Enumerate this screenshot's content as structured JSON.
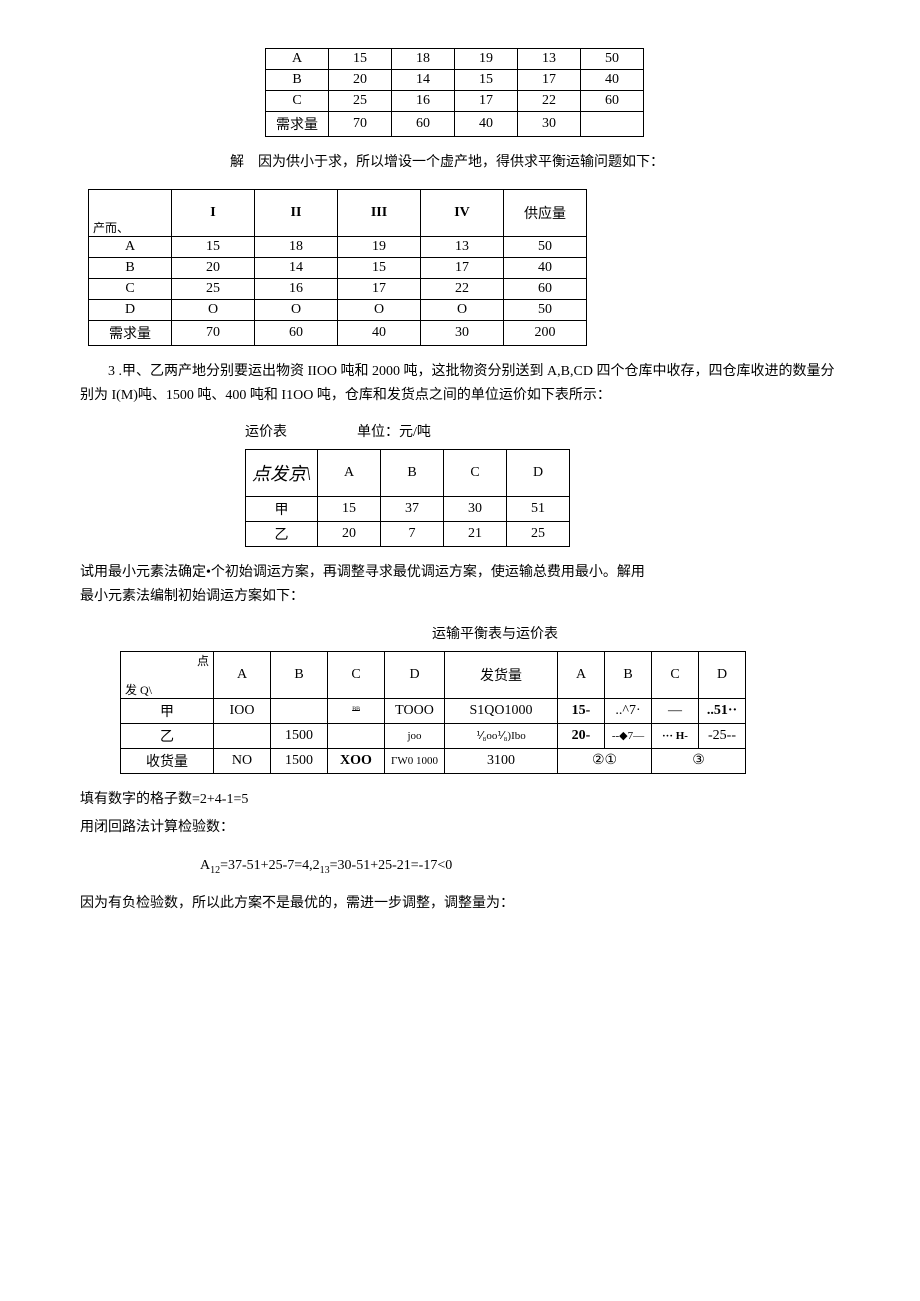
{
  "table1": {
    "rows": [
      [
        "A",
        "15",
        "18",
        "19",
        "13",
        "50"
      ],
      [
        "B",
        "20",
        "14",
        "15",
        "17",
        "40"
      ],
      [
        "C",
        "25",
        "16",
        "17",
        "22",
        "60"
      ],
      [
        "需求量",
        "70",
        "60",
        "40",
        "30",
        ""
      ]
    ]
  },
  "text1": "解　因为供小于求，所以增设一个虚产地，得供求平衡运输问题如下：",
  "table2": {
    "header_left_top": "",
    "header_left_bot": "产而、",
    "headers": [
      "I",
      "II",
      "III",
      "IV",
      "供应量"
    ],
    "rows": [
      [
        "A",
        "15",
        "18",
        "19",
        "13",
        "50"
      ],
      [
        "B",
        "20",
        "14",
        "15",
        "17",
        "40"
      ],
      [
        "C",
        "25",
        "16",
        "17",
        "22",
        "60"
      ],
      [
        "D",
        "O",
        "O",
        "O",
        "O",
        "50"
      ],
      [
        "需求量",
        "70",
        "60",
        "40",
        "30",
        "200"
      ]
    ]
  },
  "text2": "3 .甲、乙两产地分别要运出物资 IIOO 吨和 2000 吨，这批物资分别送到 A,B,CD 四个仓库中收存，四仓库收进的数量分别为 I(M)吨、1500 吨、400 吨和 I1OO 吨，仓库和发货点之间的单位运价如下表所示：",
  "table3_caption": "运价表　　　　　单位：元/吨",
  "table3": {
    "header_left": "点发京\\",
    "headers": [
      "A",
      "B",
      "C",
      "D"
    ],
    "rows": [
      [
        "甲",
        "15",
        "37",
        "30",
        "51"
      ],
      [
        "乙",
        "20",
        "7",
        "21",
        "25"
      ]
    ]
  },
  "text3a": "试用最小元素法确定•个初始调运方案，再调整寻求最优调运方案，使运输总费用最小。解用",
  "text3b": "最小元素法编制初始调运方案如下：",
  "table4_caption": "运输平衡表与运价表",
  "table4": {
    "header_left_top": "点",
    "header_left_bot": "发 Q\\",
    "headers_left": [
      "A",
      "B",
      "C",
      "D",
      "发货量"
    ],
    "headers_right": [
      "A",
      "B",
      "C",
      "D"
    ],
    "rows": [
      {
        "label": "甲",
        "left": [
          "IOO",
          "",
          "ᴮᴮ",
          "TOOO",
          "S1QO1000"
        ],
        "right": [
          "15-",
          "..^7·",
          "—",
          "..51··"
        ]
      },
      {
        "label": "乙",
        "left": [
          "",
          "1500",
          "",
          "joo",
          "⅟₈oo⅟₈)Ibo"
        ],
        "right": [
          "20-",
          "--◆7—",
          "··· H-",
          "-25--"
        ]
      },
      {
        "label": "收货量",
        "left": [
          "NO",
          "1500",
          "XOO",
          "ΓW0 1000",
          "3100"
        ],
        "right": [
          "②①",
          "",
          "③",
          ""
        ]
      }
    ]
  },
  "text4": "填有数字的格子数=2+4-1=5",
  "text5": "用闭回路法计算检验数：",
  "eq1_a": "A",
  "eq1_sub1": "12",
  "eq1_b": "=37-51+25-7=4,2",
  "eq1_sub2": "13",
  "eq1_c": "=30-51+25-21=-17<0",
  "text6": "因为有负检验数，所以此方案不是最优的，需进一步调整，调整量为："
}
